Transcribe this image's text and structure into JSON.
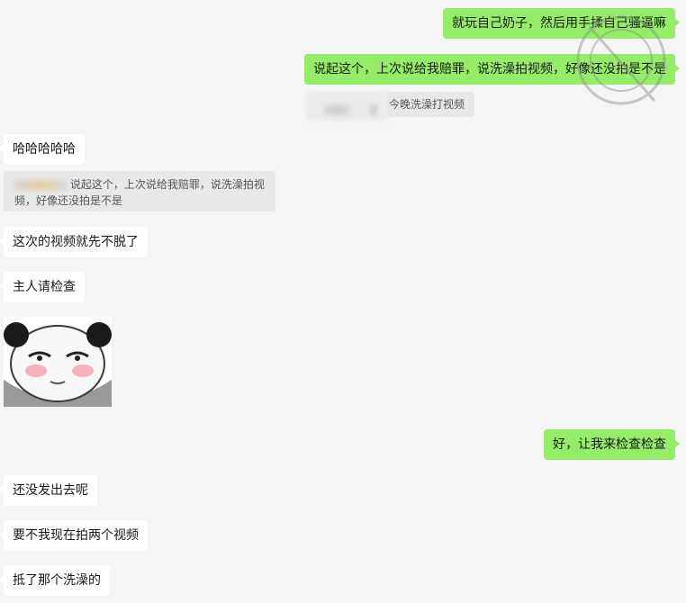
{
  "messages": {
    "m1": "就玩自己奶子，然后用手揉自己骚逼嘛",
    "m2": "说起这个，上次说给我赔罪，说洗澡拍视频，好像还没拍是不是",
    "m2_quote": "今晚洗澡打视频",
    "m3": "哈哈哈哈哈",
    "m3_quote": "说起这个，上次说给我赔罪，说洗澡拍视频，好像还没拍是不是",
    "m4": "这次的视频就先不脱了",
    "m5": "主人请检查",
    "m6": "好，让我来检查检查",
    "m7": "还没发出去呢",
    "m8": "要不我现在拍两个视频",
    "m9": "抵了那个洗澡的"
  },
  "sticker": {
    "name": "panda-blush-sticker"
  },
  "colors": {
    "self_bubble": "#95ec69",
    "other_bubble": "#ffffff",
    "background": "#f5f5f5"
  }
}
